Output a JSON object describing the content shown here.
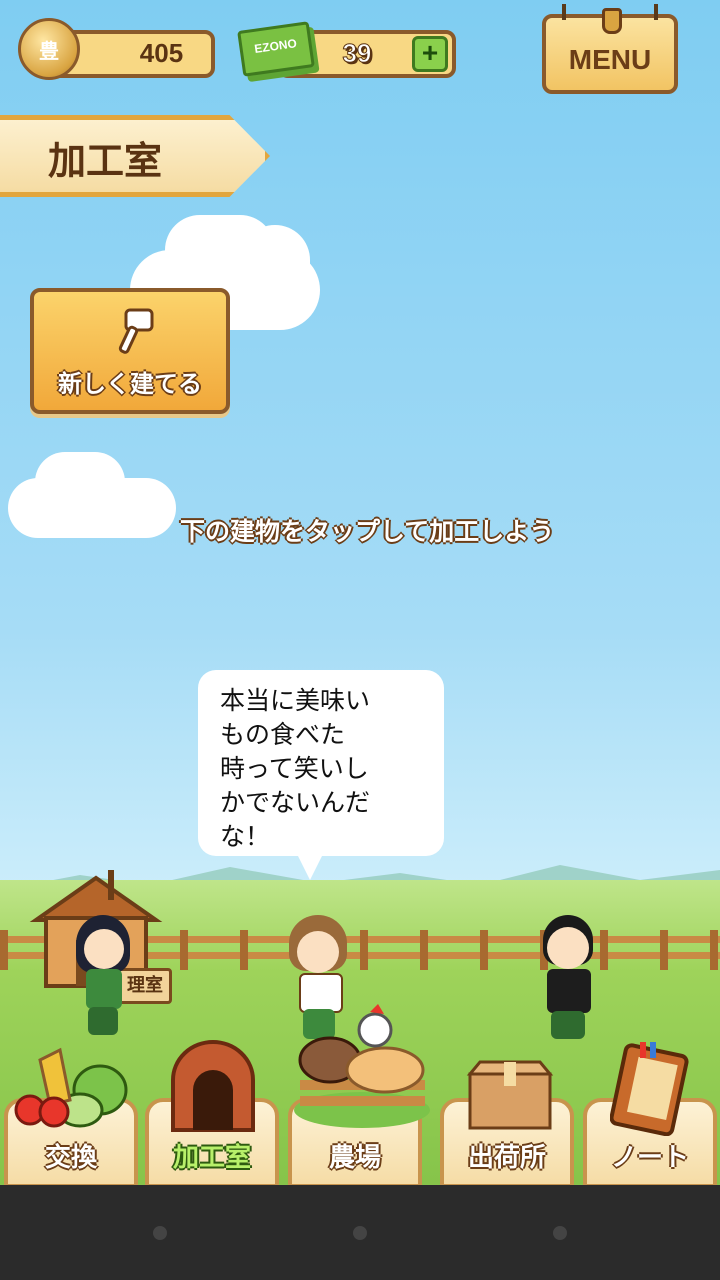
{
  "hud": {
    "coin_value": "405",
    "coin_glyph": "豊",
    "ticket_brand": "EZONO",
    "ticket_value": "39",
    "plus_label": "+",
    "menu_label": "MENU"
  },
  "screen_title": "加工室",
  "build_button": {
    "label": "新しく建てる",
    "icon": "hammer-icon"
  },
  "instruction": "下の建物をタップして加工しよう",
  "speech_bubble": "本当に美味い\nもの食べた\n時って笑いし\nかでないんだ\nな！",
  "building_sign": "理室",
  "bottom_tabs": [
    {
      "label": "交換",
      "icon": "vegetables-icon",
      "active": false
    },
    {
      "label": "加工室",
      "icon": "brick-oven-icon",
      "active": true
    },
    {
      "label": "農場",
      "icon": "farm-animals-icon",
      "active": false
    },
    {
      "label": "出荷所",
      "icon": "shipping-box-icon",
      "active": false
    },
    {
      "label": "ノート",
      "icon": "notebook-icon",
      "active": false
    }
  ],
  "colors": {
    "accent_wood": "#8a5a2b",
    "active_tab_text": "#b8f06a",
    "sky": "#8fd3f3"
  }
}
